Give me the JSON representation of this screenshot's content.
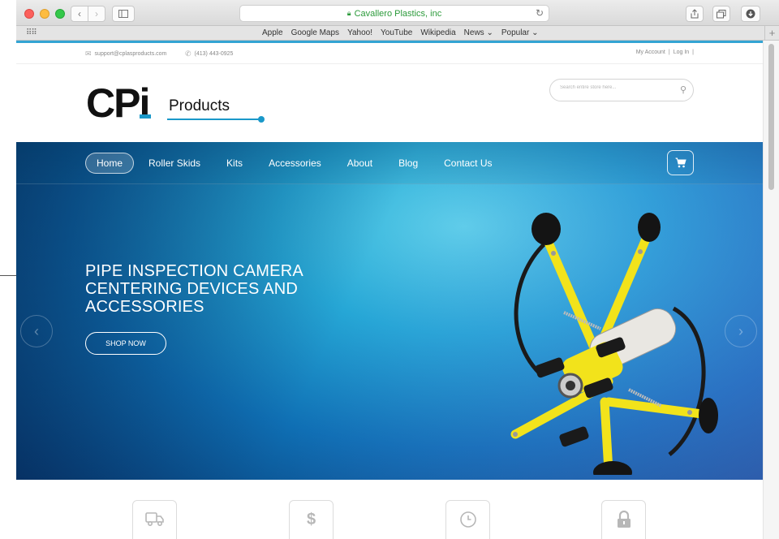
{
  "browser": {
    "url_display": "Cavallero Plastics, inc",
    "bookmarks": [
      "Apple",
      "Google Maps",
      "Yahoo!",
      "YouTube",
      "Wikipedia",
      "News ⌄",
      "Popular ⌄"
    ]
  },
  "topbar": {
    "email": "support@cplasproducts.com",
    "phone": "(413) 443-0925",
    "my_account": "My Account",
    "separator": "|",
    "log_in": "Log In",
    "trailing_separator": "|"
  },
  "logo": {
    "brand": "CPi",
    "brand_cp": "CP",
    "brand_i": "i",
    "suffix": "Products"
  },
  "search": {
    "placeholder": "Search entire store here..."
  },
  "nav": {
    "items": [
      "Home",
      "Roller Skids",
      "Kits",
      "Accessories",
      "About",
      "Blog",
      "Contact Us"
    ],
    "active_index": 0
  },
  "hero": {
    "title_lines": [
      "PIPE INSPECTION CAMERA",
      "CENTERING DEVICES AND",
      "ACCESSORIES"
    ],
    "cta": "SHOP NOW"
  },
  "features": {
    "icons": [
      "truck-icon",
      "dollar-icon",
      "clock-icon",
      "lock-icon"
    ]
  },
  "colors": {
    "accent": "#1a98c9",
    "url_green": "#2b9a3a",
    "product_yellow": "#f2e31b"
  }
}
